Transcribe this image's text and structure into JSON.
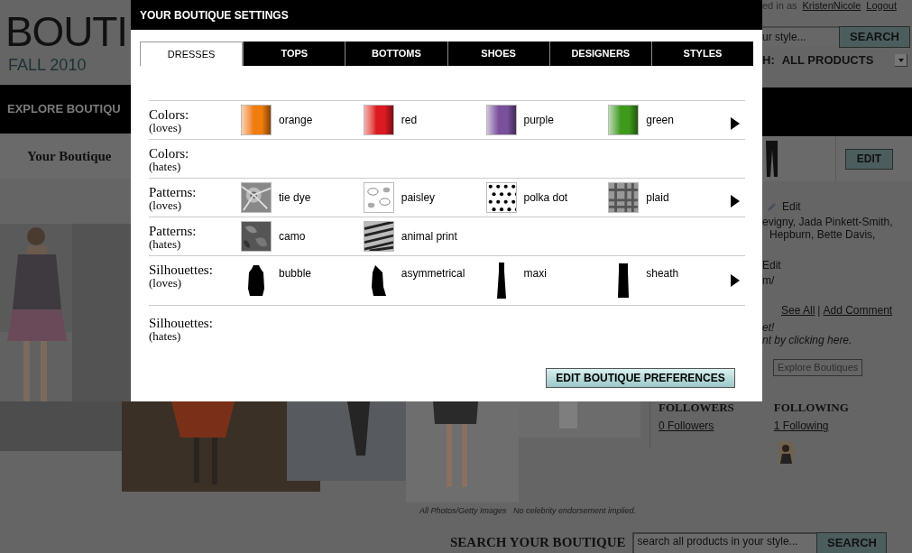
{
  "header": {
    "logo": "BOUTI",
    "season": "FALL 2010",
    "nav_item": "EXPLORE BOUTIQU",
    "section_title": "Your Boutique",
    "login_text": "ed in as",
    "username": "KristenNicole",
    "logout": "Logout",
    "search": {
      "value": "ur style...",
      "button": "SEARCH"
    },
    "scope": {
      "label": "H:",
      "value": "ALL PRODUCTS"
    },
    "edit_button": "EDIT"
  },
  "profile": {
    "edit_link": "Edit",
    "celebrities": [
      "evigny, Jada Pinkett-Smith,",
      "Hepburn, Bette Davis,"
    ],
    "second_edit": "Edit",
    "url": "m/",
    "see_all": "See All",
    "separator": "|",
    "add_comment": "Add Comment",
    "comment_note": [
      "et!",
      "nt by clicking here."
    ],
    "explore_button": "Explore Boutiques"
  },
  "social": {
    "followers_title": "FOLLOWERS",
    "followers_link": "0 Followers",
    "following_title": "FOLLOWING",
    "following_link": "1 Following"
  },
  "caption": "All Photos/Getty Images   No celebrity endorsement implied.",
  "bottom_search": {
    "title": "SEARCH YOUR BOUTIQUE",
    "value": "search all products in your style...",
    "button": "SEARCH"
  },
  "dialog": {
    "title": "YOUR BOUTIQUE SETTINGS",
    "tabs": [
      {
        "label": "DRESSES",
        "selected": true
      },
      {
        "label": "TOPS",
        "selected": false
      },
      {
        "label": "BOTTOMS",
        "selected": false
      },
      {
        "label": "SHOES",
        "selected": false
      },
      {
        "label": "DESIGNERS",
        "selected": false
      },
      {
        "label": "STYLES",
        "selected": false
      }
    ],
    "rows": [
      {
        "category": "Colors:",
        "sentiment": "(loves)",
        "more": true,
        "items": [
          {
            "kind": "color",
            "color": "#f07d0c",
            "label": "orange"
          },
          {
            "kind": "color",
            "color": "#dc1a22",
            "label": "red"
          },
          {
            "kind": "color",
            "color": "#7a4f9c",
            "label": "purple"
          },
          {
            "kind": "color",
            "color": "#3f9a1c",
            "label": "green"
          }
        ]
      },
      {
        "category": "Colors:",
        "sentiment": "(hates)",
        "more": false,
        "items": []
      },
      {
        "category": "Patterns:",
        "sentiment": "(loves)",
        "more": true,
        "items": [
          {
            "kind": "tiedye",
            "label": "tie dye"
          },
          {
            "kind": "paisley",
            "label": "paisley"
          },
          {
            "kind": "dots",
            "label": "polka dot"
          },
          {
            "kind": "plaid",
            "label": "plaid"
          }
        ]
      },
      {
        "category": "Patterns:",
        "sentiment": "(hates)",
        "more": false,
        "items": [
          {
            "kind": "camo",
            "label": "camo"
          },
          {
            "kind": "zebra",
            "label": "animal print"
          }
        ]
      },
      {
        "category": "Silhouettes:",
        "sentiment": "(loves)",
        "more": true,
        "items": [
          {
            "kind": "coat",
            "label": "bubble"
          },
          {
            "kind": "oneshoulder",
            "label": "asymmetrical"
          },
          {
            "kind": "gown",
            "label": "maxi"
          },
          {
            "kind": "sheath",
            "label": "sheath"
          }
        ]
      },
      {
        "category": "Silhouettes:",
        "sentiment": "(hates)",
        "more": false,
        "items": []
      }
    ],
    "button": "EDIT BOUTIQUE PREFERENCES"
  }
}
